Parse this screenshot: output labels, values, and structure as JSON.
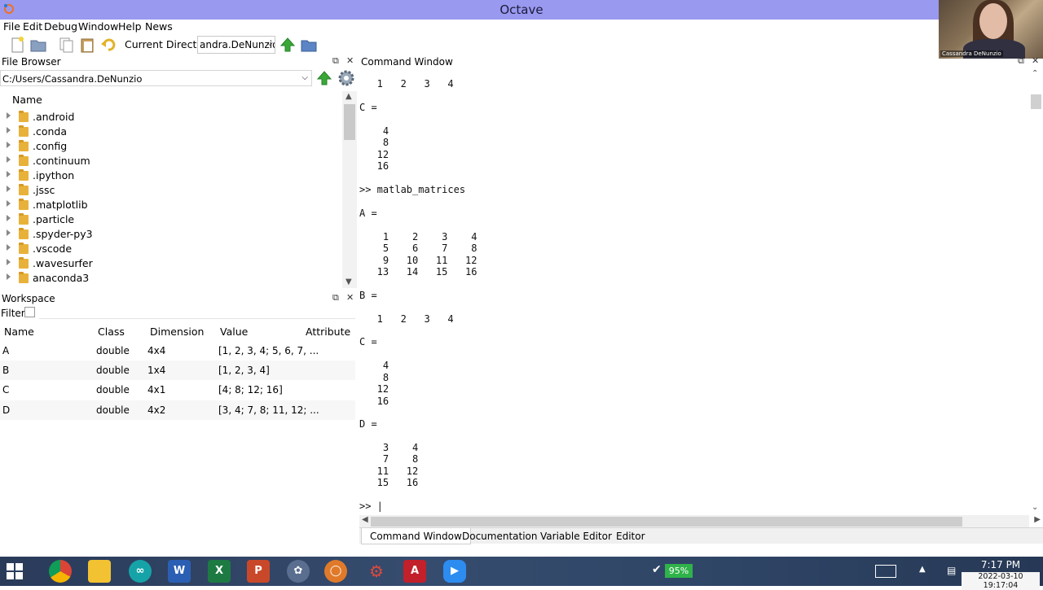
{
  "window": {
    "title": "Octave"
  },
  "menu": [
    "File",
    "Edit",
    "Debug",
    "Window",
    "Help",
    "News"
  ],
  "toolbar": {
    "current_dir_label": "Current Directory:",
    "current_dir_value": "andra.DeNunzio"
  },
  "file_browser": {
    "title": "File Browser",
    "path": "C:/Users/Cassandra.DeNunzio",
    "column": "Name",
    "items": [
      ".android",
      ".conda",
      ".config",
      ".continuum",
      ".ipython",
      ".jssc",
      ".matplotlib",
      ".particle",
      ".spyder-py3",
      ".vscode",
      ".wavesurfer",
      "anaconda3"
    ]
  },
  "workspace": {
    "title": "Workspace",
    "filter_label": "Filter",
    "columns": [
      "Name",
      "Class",
      "Dimension",
      "Value",
      "Attribute"
    ],
    "rows": [
      [
        "A",
        "double",
        "4x4",
        "[1, 2, 3, 4; 5, 6, 7, ...",
        ""
      ],
      [
        "B",
        "double",
        "1x4",
        "[1, 2, 3, 4]",
        ""
      ],
      [
        "C",
        "double",
        "4x1",
        "[4; 8; 12; 16]",
        ""
      ],
      [
        "D",
        "double",
        "4x2",
        "[3, 4; 7, 8; 11, 12; ...",
        ""
      ]
    ]
  },
  "command_window": {
    "title": "Command Window",
    "lines": [
      "   1   2   3   4",
      "C =",
      "    4",
      "    8",
      "   12",
      "   16",
      ">> matlab_matrices",
      "A =",
      "    1    2    3    4",
      "    5    6    7    8",
      "    9   10   11   12",
      "   13   14   15   16",
      "B =",
      "   1   2   3   4",
      "C =",
      "    4",
      "    8",
      "   12",
      "   16",
      "D =",
      "    3    4",
      "    7    8",
      "   11   12",
      "   15   16",
      ">> |"
    ]
  },
  "tabs": [
    "Command Window",
    "Documentation",
    "Variable Editor",
    "Editor"
  ],
  "taskbar": {
    "battery": "95%",
    "time": "7:17 PM",
    "date": "2022-03-10 19:17:04"
  },
  "webcam": {
    "name": "Cassandra DeNunzio"
  },
  "colors": {
    "titlebar": "#9999f0",
    "folder": "#e8b23a",
    "taskbar": "#2f4566"
  }
}
